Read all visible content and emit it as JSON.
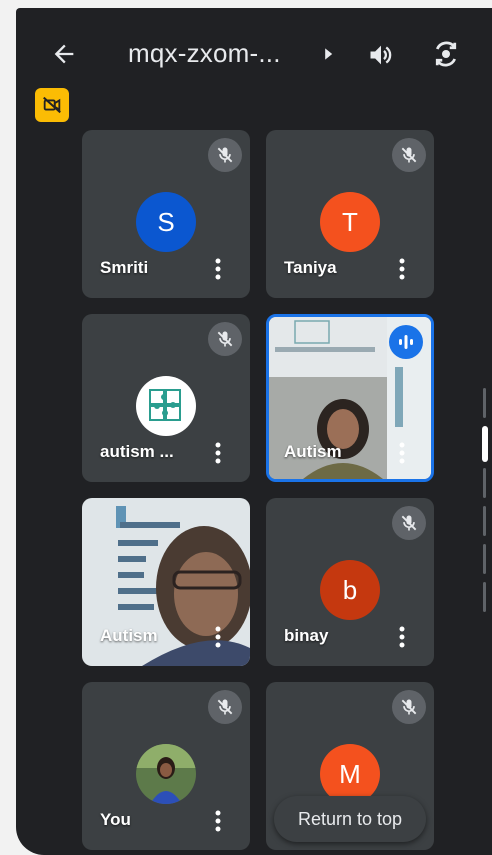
{
  "header": {
    "meeting_code": "mqx-zxom-...",
    "icons": [
      "back-arrow-icon",
      "chevron-right-icon",
      "speaker-icon",
      "camera-flip-icon",
      "camera-off-icon"
    ]
  },
  "participants": [
    {
      "name": "Smriti",
      "initial": "S",
      "color": "#0b57d0",
      "mic": "muted"
    },
    {
      "name": "Taniya",
      "initial": "T",
      "color": "#f4511e",
      "mic": "muted"
    },
    {
      "name": "autism ...",
      "initial": "",
      "color": "#ffffff",
      "mic": "muted"
    },
    {
      "name": "Autism",
      "initial": "",
      "color": "",
      "mic": "speaking"
    },
    {
      "name": "Autism",
      "initial": "",
      "color": "",
      "mic": "unmuted"
    },
    {
      "name": "binay",
      "initial": "b",
      "color": "#c5380f",
      "mic": "muted"
    },
    {
      "name": "You",
      "initial": "",
      "color": "",
      "mic": "muted"
    },
    {
      "name": "",
      "initial": "M",
      "color": "#f4511e",
      "mic": "muted"
    }
  ],
  "return_button": {
    "label": "Return to top"
  },
  "colors": {
    "background": "#202124",
    "tile": "#3c4043",
    "accent": "#1a73e8",
    "badge": "#fbbc04"
  }
}
